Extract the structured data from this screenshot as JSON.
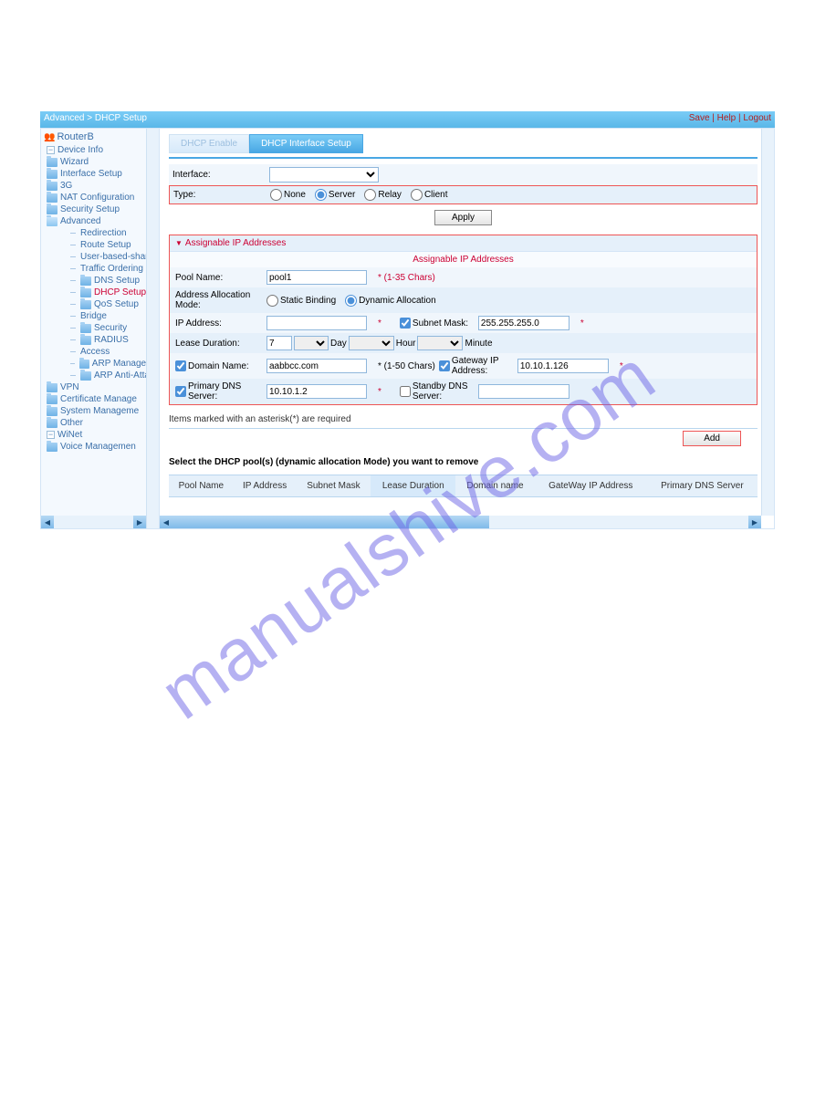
{
  "breadcrumb": "Advanced > DHCP Setup",
  "toplinks": {
    "save": "Save",
    "sep": " | ",
    "help": "Help",
    "logout": "Logout"
  },
  "router": "RouterB",
  "tree": {
    "device_info": "Device Info",
    "wizard": "Wizard",
    "interface_setup": "Interface Setup",
    "three_g": "3G",
    "nat_config": "NAT Configuration",
    "security_setup": "Security Setup",
    "advanced": "Advanced",
    "adv": {
      "redirection": "Redirection",
      "route_setup": "Route Setup",
      "user_based": "User-based-sharin",
      "traffic_ordering": "Traffic Ordering",
      "dns_setup": "DNS Setup",
      "dhcp_setup": "DHCP Setup",
      "qos_setup": "QoS Setup",
      "bridge": "Bridge",
      "security": "Security",
      "radius": "RADIUS",
      "access": "Access",
      "arp_management": "ARP Manageme",
      "arp_anti": "ARP Anti-Attacl"
    },
    "vpn": "VPN",
    "cert_manage": "Certificate Manage",
    "sys_manage": "System Manageme",
    "other": "Other",
    "winet": "WiNet",
    "voice": "Voice Managemen"
  },
  "tabs": {
    "enable": "DHCP Enable",
    "iface": "DHCP Interface Setup"
  },
  "form": {
    "interface_label": "Interface:",
    "type_label": "Type:",
    "type_opts": {
      "none": "None",
      "server": "Server",
      "relay": "Relay",
      "client": "Client"
    },
    "apply": "Apply"
  },
  "panel": {
    "header": "Assignable IP Addresses",
    "title": "Assignable IP Addresses",
    "pool_name_label": "Pool Name:",
    "pool_name": "pool1",
    "pool_hint": "* (1-35 Chars)",
    "alloc_label": "Address Allocation Mode:",
    "alloc_static": "Static Binding",
    "alloc_dynamic": "Dynamic Allocation",
    "ip_label": "IP Address:",
    "subnet_label": "Subnet Mask:",
    "subnet": "255.255.255.0",
    "lease_label": "Lease Duration:",
    "lease_day": "7",
    "day": "Day",
    "hour": "Hour",
    "minute": "Minute",
    "domain_label": "Domain Name:",
    "domain": "aabbcc.com",
    "domain_hint": "* (1-50 Chars)",
    "gw_label": "Gateway IP Address:",
    "gw": "10.10.1.126",
    "pdns_label": "Primary DNS Server:",
    "pdns": "10.10.1.2",
    "sdns_label": "Standby DNS Server:"
  },
  "note": "Items marked with an asterisk(*) are required",
  "add": "Add",
  "select_text": "Select the DHCP pool(s) (dynamic allocation Mode) you want to remove",
  "cols": {
    "pool": "Pool Name",
    "ip": "IP Address",
    "subnet": "Subnet Mask",
    "lease": "Lease Duration",
    "domain": "Domain name",
    "gw": "GateWay IP Address",
    "pdns": "Primary DNS Server"
  },
  "watermark": "manualshive.com"
}
